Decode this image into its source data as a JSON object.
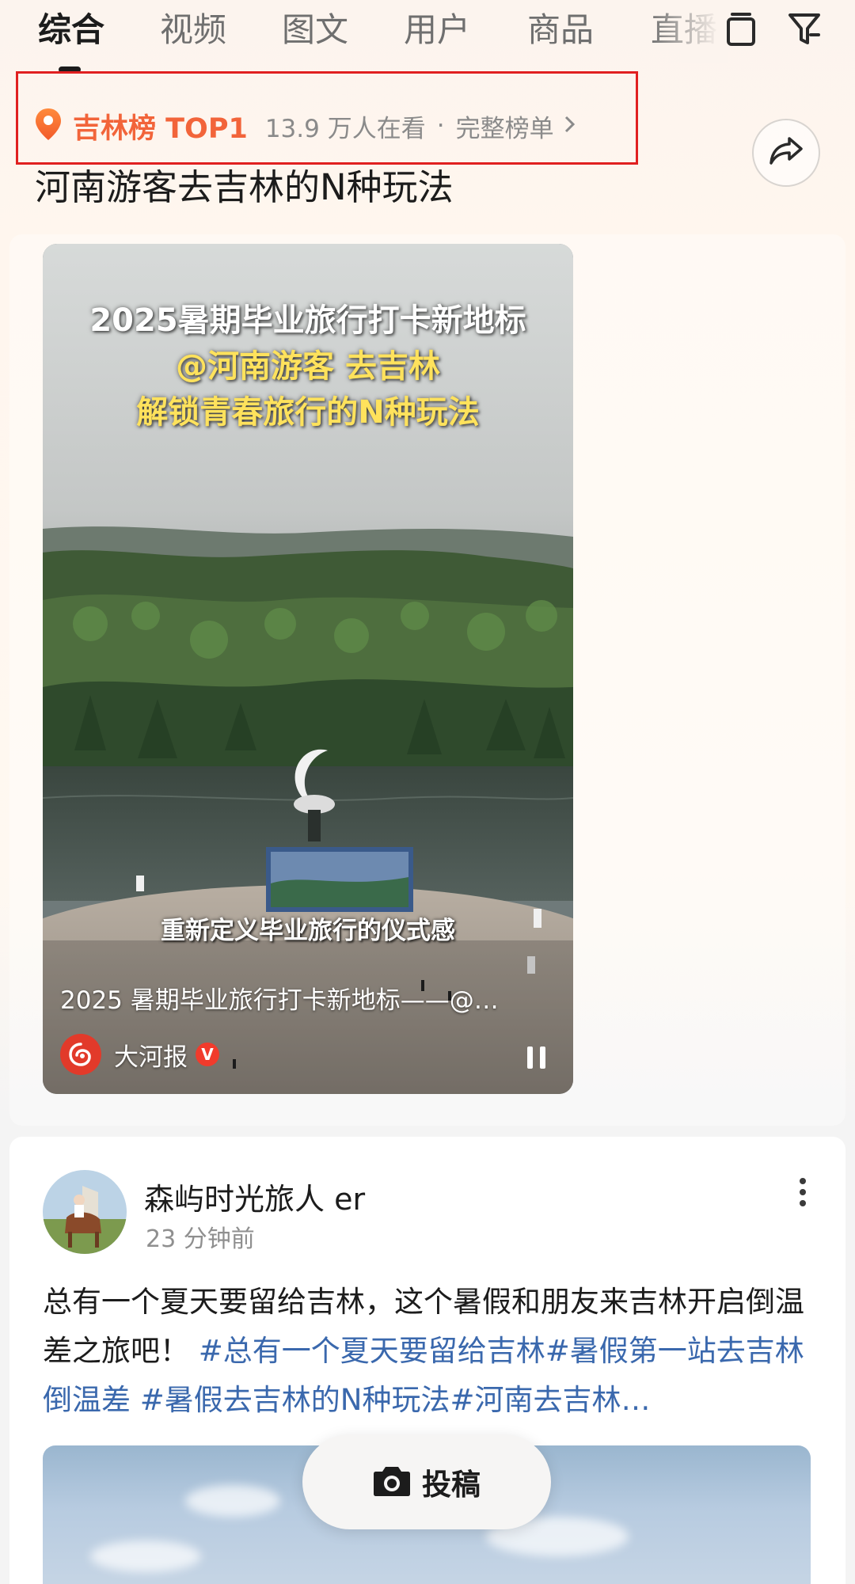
{
  "tabs": {
    "items": [
      {
        "label": "综合",
        "active": true
      },
      {
        "label": "视频",
        "active": false
      },
      {
        "label": "图文",
        "active": false
      },
      {
        "label": "用户",
        "active": false
      },
      {
        "label": "商品",
        "active": false
      },
      {
        "label": "直播",
        "active": false
      }
    ],
    "icons": [
      "tablet-icon",
      "filter-icon"
    ]
  },
  "rank": {
    "icon": "location-pin-icon",
    "title": "吉林榜 TOP1",
    "viewers": "13.9 万人在看",
    "separator": "·",
    "link_label": "完整榜单",
    "link_icon": "chevron-right-icon",
    "accent_color": "#f2643a",
    "highlight_border_color": "#e02020"
  },
  "share": {
    "icon": "share-icon"
  },
  "headline": "河南游客去吉林的N种玩法",
  "video": {
    "overlay_line1": "2025暑期毕业旅行打卡新地标",
    "overlay_line2": "@河南游客 去吉林",
    "overlay_line3": "解锁青春旅行的N种玩法",
    "subtitle": "重新定义毕业旅行的仪式感",
    "caption": "2025 暑期毕业旅行打卡新地标——@…",
    "author": "大河报",
    "verified_badge": "V",
    "pause_icon": "pause-icon"
  },
  "post": {
    "author": "森屿时光旅人 er",
    "time": "23 分钟前",
    "more_icon": "more-vertical-icon",
    "text_plain": "总有一个夏天要留给吉林，这个暑假和朋友来吉林开启倒温差之旅吧！",
    "tag1": "#总有一个夏天要留给吉林",
    "tag2": "#暑假第一站去吉林倒温差",
    "tag3": "#暑假去吉林的N种玩法",
    "tag4": "#河南去吉林…",
    "link_color": "#3a68ad"
  },
  "post_button": {
    "icon": "camera-icon",
    "label": "投稿"
  }
}
